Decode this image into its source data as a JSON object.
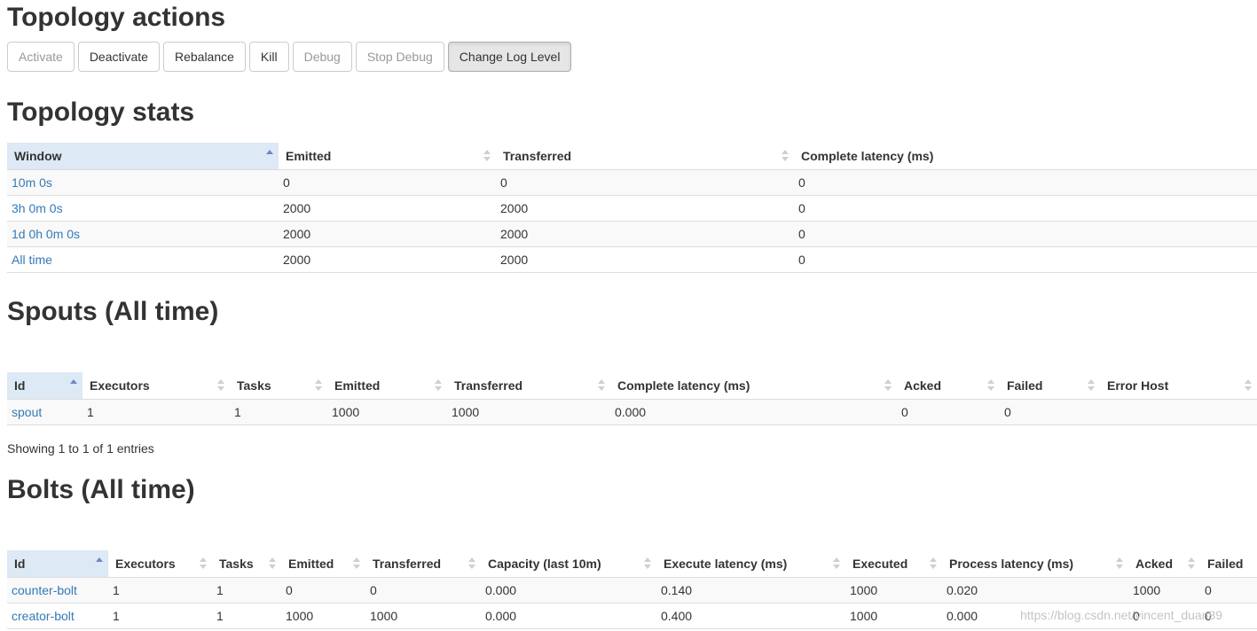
{
  "actions": {
    "title": "Topology actions",
    "buttons": {
      "activate": "Activate",
      "deactivate": "Deactivate",
      "rebalance": "Rebalance",
      "kill": "Kill",
      "debug": "Debug",
      "stop_debug": "Stop Debug",
      "change_log_level": "Change Log Level"
    }
  },
  "stats": {
    "title": "Topology stats",
    "headers": [
      "Window",
      "Emitted",
      "Transferred",
      "Complete latency (ms)"
    ],
    "rows": [
      [
        "10m 0s",
        "0",
        "0",
        "0"
      ],
      [
        "3h 0m 0s",
        "2000",
        "2000",
        "0"
      ],
      [
        "1d 0h 0m 0s",
        "2000",
        "2000",
        "0"
      ],
      [
        "All time",
        "2000",
        "2000",
        "0"
      ]
    ]
  },
  "spouts": {
    "title": "Spouts (All time)",
    "headers": [
      "Id",
      "Executors",
      "Tasks",
      "Emitted",
      "Transferred",
      "Complete latency (ms)",
      "Acked",
      "Failed",
      "Error Host"
    ],
    "rows": [
      [
        "spout",
        "1",
        "1",
        "1000",
        "1000",
        "0.000",
        "0",
        "0",
        ""
      ]
    ],
    "info": "Showing 1 to 1 of 1 entries"
  },
  "bolts": {
    "title": "Bolts (All time)",
    "headers": [
      "Id",
      "Executors",
      "Tasks",
      "Emitted",
      "Transferred",
      "Capacity (last 10m)",
      "Execute latency (ms)",
      "Executed",
      "Process latency (ms)",
      "Acked",
      "Failed"
    ],
    "rows": [
      [
        "counter-bolt",
        "1",
        "1",
        "0",
        "0",
        "0.000",
        "0.140",
        "1000",
        "0.020",
        "1000",
        "0"
      ],
      [
        "creator-bolt",
        "1",
        "1",
        "1000",
        "1000",
        "0.000",
        "0.400",
        "1000",
        "0.000",
        "0",
        "0"
      ]
    ]
  },
  "watermark": "https://blog.csdn.net/vincent_duan89",
  "colors": {
    "link": "#337ab7",
    "sorted_header": "#dde9f5",
    "stripe": "#f9f9f9"
  }
}
